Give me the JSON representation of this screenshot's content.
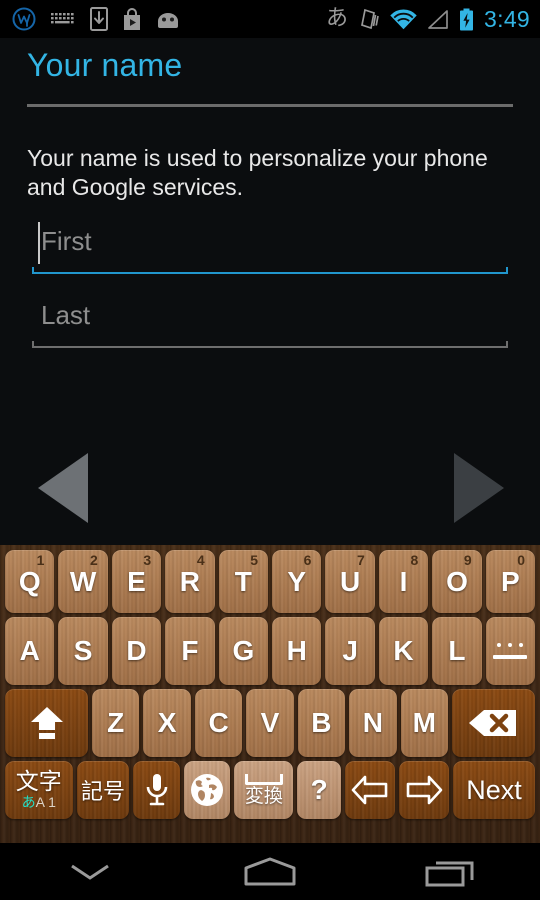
{
  "statusbar": {
    "left_icons": [
      {
        "name": "whatsapp-logo-icon",
        "glyph": "W"
      },
      {
        "name": "keyboard-icon",
        "glyph": "keyboard"
      },
      {
        "name": "download-to-device-icon",
        "glyph": "download"
      },
      {
        "name": "play-store-icon",
        "glyph": "bag"
      },
      {
        "name": "android-robot-icon",
        "glyph": "android"
      }
    ],
    "ime_indicator": "あ",
    "right_icons": [
      {
        "name": "vibrate-icon"
      },
      {
        "name": "wifi-icon"
      },
      {
        "name": "cell-signal-icon"
      },
      {
        "name": "battery-charging-icon"
      }
    ],
    "clock": "3:49",
    "accent_color": "#33b5e5"
  },
  "page": {
    "title": "Your name",
    "description": "Your name is used to personalize your phone and Google services.",
    "title_color": "#33b5e5"
  },
  "form": {
    "first": {
      "label": "first-name",
      "value": "",
      "placeholder": "First",
      "focused": true,
      "underline_color": "#2196cd"
    },
    "last": {
      "label": "last-name",
      "value": "",
      "placeholder": "Last",
      "focused": false,
      "underline_color": "#6e6e6e"
    }
  },
  "wizard_nav": {
    "back": {
      "name": "back-arrow",
      "color": "#6d7175"
    },
    "next": {
      "name": "next-arrow",
      "color": "#3b3f43"
    }
  },
  "keyboard": {
    "theme": "wood",
    "row1": [
      {
        "label": "Q",
        "num": "1"
      },
      {
        "label": "W",
        "num": "2"
      },
      {
        "label": "E",
        "num": "3"
      },
      {
        "label": "R",
        "num": "4"
      },
      {
        "label": "T",
        "num": "5"
      },
      {
        "label": "Y",
        "num": "6"
      },
      {
        "label": "U",
        "num": "7"
      },
      {
        "label": "I",
        "num": "8"
      },
      {
        "label": "O",
        "num": "9"
      },
      {
        "label": "P",
        "num": "0"
      }
    ],
    "row2": [
      {
        "label": "A"
      },
      {
        "label": "S"
      },
      {
        "label": "D"
      },
      {
        "label": "F"
      },
      {
        "label": "G"
      },
      {
        "label": "H"
      },
      {
        "label": "J"
      },
      {
        "label": "K"
      },
      {
        "label": "L"
      }
    ],
    "row2_special": {
      "name": "ellipsis-dash-key",
      "label": "…—"
    },
    "row3": [
      {
        "label": "Z"
      },
      {
        "label": "X"
      },
      {
        "label": "C"
      },
      {
        "label": "V"
      },
      {
        "label": "B"
      },
      {
        "label": "N"
      },
      {
        "label": "M"
      }
    ],
    "shift_key": {
      "name": "shift-key",
      "label": "shift"
    },
    "backspace_key": {
      "name": "backspace-key",
      "label": "backspace"
    },
    "row4": {
      "mode_key": {
        "main": "文字",
        "sub_hira": "あ",
        "sub_rest": "A 1"
      },
      "symbol_key": "記号",
      "mic_key": "mic",
      "globe_key": "globe",
      "convert_key": "変換",
      "question_key": "?",
      "left_arrow_key": "left",
      "right_arrow_key": "right",
      "next_key": "Next"
    }
  },
  "navbar": {
    "back": "hide-keyboard-chevron",
    "home": "home",
    "recents": "recent-apps"
  }
}
